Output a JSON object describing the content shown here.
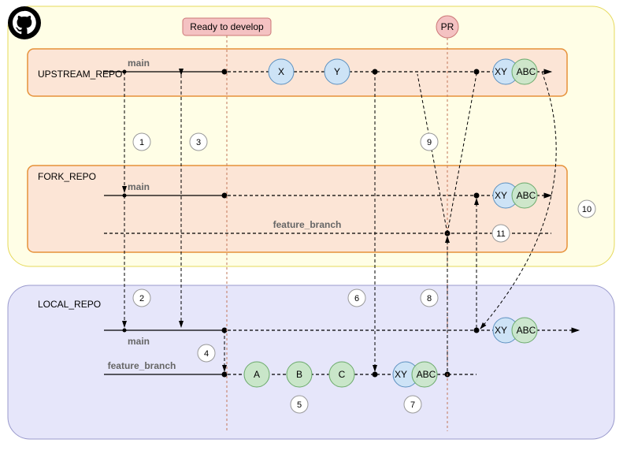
{
  "labels": {
    "ready": "Ready to develop",
    "pr": "PR"
  },
  "repos": {
    "upstream": "UPSTREAM_REPO",
    "fork": "FORK_REPO",
    "local": "LOCAL_REPO"
  },
  "branches": {
    "main": "main",
    "feature": "feature_branch"
  },
  "commits": {
    "X": "X",
    "Y": "Y",
    "A": "A",
    "B": "B",
    "C": "C",
    "XY": "XY",
    "ABC": "ABC"
  },
  "steps": {
    "s1": "1",
    "s2": "2",
    "s3": "3",
    "s4": "4",
    "s5": "5",
    "s6": "6",
    "s7": "7",
    "s8": "8",
    "s9": "9",
    "s10": "10",
    "s11": "11"
  }
}
